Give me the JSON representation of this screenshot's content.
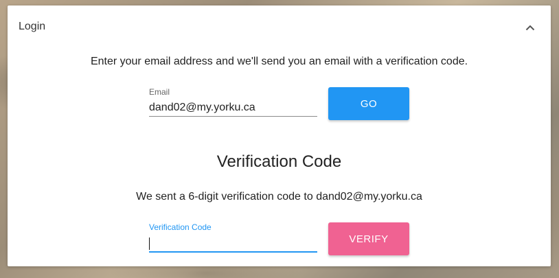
{
  "header": {
    "title": "Login",
    "collapse_icon": "chevron-up-icon"
  },
  "email_section": {
    "instruction": "Enter your email address and we'll send you an email with a verification code.",
    "email_label": "Email",
    "email_value": "dand02@my.yorku.ca",
    "go_label": "GO",
    "go_color": "#2196f3"
  },
  "verification_section": {
    "title": "Verification Code",
    "message": "We sent a 6-digit verification code to dand02@my.yorku.ca",
    "code_label": "Verification Code",
    "code_value": "",
    "verify_label": "VERIFY",
    "verify_color": "#f06292",
    "focus_color": "#2196f3"
  }
}
